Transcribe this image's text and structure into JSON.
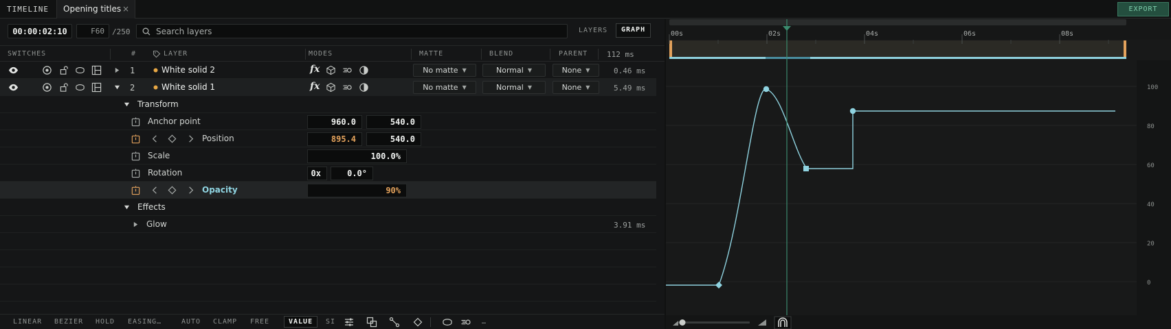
{
  "tabs": {
    "panel_label": "TIMELINE",
    "document_title": "Opening titles",
    "close_glyph": "×",
    "export_label": "EXPORT"
  },
  "toolbar": {
    "timecode": "00:00:02:10",
    "frame": "F60",
    "total": "/250",
    "search_placeholder": "Search layers",
    "view_layers": "LAYERS",
    "view_graph": "GRAPH"
  },
  "columns": {
    "switches": "SWITCHES",
    "index": "#",
    "layer": "LAYER",
    "modes": "MODES",
    "matte": "MATTE",
    "blend": "BLEND",
    "parent": "PARENT",
    "timing": "112 ms"
  },
  "layers": [
    {
      "index": "1",
      "name": "White solid 2",
      "matte": "No matte",
      "blend": "Normal",
      "parent": "None",
      "timing": "0.46 ms"
    },
    {
      "index": "2",
      "name": "White solid 1",
      "matte": "No matte",
      "blend": "Normal",
      "parent": "None",
      "timing": "5.49 ms"
    }
  ],
  "transform": {
    "group_label": "Transform",
    "anchor": {
      "label": "Anchor point",
      "x": "960.0",
      "y": "540.0"
    },
    "position": {
      "label": "Position",
      "x": "895.4",
      "y": "540.0"
    },
    "scale": {
      "label": "Scale",
      "value": "100.0%"
    },
    "rotation": {
      "label": "Rotation",
      "turns": "0x",
      "degrees": "0.0°"
    },
    "opacity": {
      "label": "Opacity",
      "value": "90%"
    }
  },
  "effects": {
    "group_label": "Effects",
    "glow": {
      "label": "Glow",
      "timing": "3.91 ms"
    }
  },
  "bottombar": {
    "linear": "LINEAR",
    "bezier": "BEZIER",
    "hold": "HOLD",
    "easing": "EASING…",
    "auto": "AUTO",
    "clamp": "CLAMP",
    "free": "FREE",
    "value": "VALUE",
    "si": "SI",
    "more": "…"
  },
  "graph": {
    "time_labels": [
      "00s",
      "02s",
      "04s",
      "06s",
      "08s"
    ],
    "value_labels": [
      "100",
      "80",
      "60",
      "40",
      "20",
      "0"
    ],
    "playhead_time": "02s",
    "curve_color": "#8fd3e0",
    "accent_color": "#e3a25c",
    "playhead_color": "#3b8a6e"
  },
  "colors": {
    "layer_dot": "#e8a845",
    "opacity_label": "#8fd3e0"
  }
}
